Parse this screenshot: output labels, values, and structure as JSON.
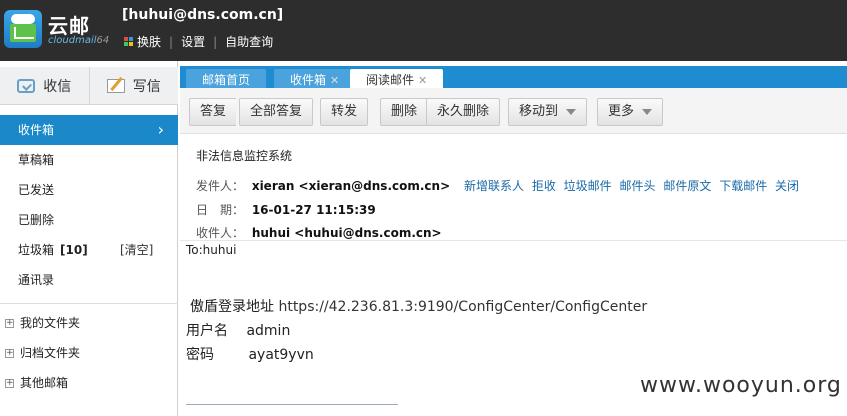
{
  "app": {
    "logo_name": "云邮",
    "logo_sub": "cloudmail",
    "logo_sub_ver": "64",
    "account": "[huhui@dns.com.cn]",
    "links": [
      "换肤",
      "设置",
      "自助查询"
    ]
  },
  "sidebar": {
    "inbox_btn": "收信",
    "compose_btn": "写信",
    "folders": [
      {
        "label": "收件箱",
        "active": true
      },
      {
        "label": "草稿箱"
      },
      {
        "label": "已发送"
      },
      {
        "label": "已删除"
      },
      {
        "label": "垃圾箱",
        "count": "[10]",
        "clear": "[清空]"
      },
      {
        "label": "通讯录"
      }
    ],
    "tree": [
      "我的文件夹",
      "归档文件夹",
      "其他邮箱"
    ]
  },
  "tabs": [
    {
      "label": "邮箱首页",
      "closable": false
    },
    {
      "label": "收件箱",
      "closable": true
    },
    {
      "label": "阅读邮件",
      "closable": true,
      "active": true
    }
  ],
  "toolbar": {
    "reply": "答复",
    "reply_all": "全部答复",
    "forward": "转发",
    "delete": "删除",
    "delete_perm": "永久删除",
    "move_to": "移动到",
    "more": "更多"
  },
  "mail": {
    "subject": "非法信息监控系统",
    "from_label": "发件人：",
    "from_value": "xieran <xieran@dns.com.cn>",
    "from_actions": [
      "新增联系人",
      "拒收",
      "垃圾邮件",
      "邮件头",
      "邮件原文",
      "下载邮件",
      "关闭"
    ],
    "date_label": "日　期：",
    "date_value": "16-01-27 11:15:39",
    "to_label": "收件人：",
    "to_value": "huhui <huhui@dns.com.cn>"
  },
  "body": {
    "to_line": "To:huhui",
    "line1_label": "傲盾登录地址",
    "line1_url": "https://42.236.81.3:9190/ConfigCenter/ConfigCenter",
    "line2_label": "用户名",
    "line2_value": "admin",
    "line3_label": "密码",
    "line3_value": "ayat9yvn"
  },
  "watermark": "www.wooyun.org",
  "colors": {
    "topbar": "#2d2d2d",
    "accent": "#1a88c9",
    "tabbar": "#1f8bd0"
  }
}
